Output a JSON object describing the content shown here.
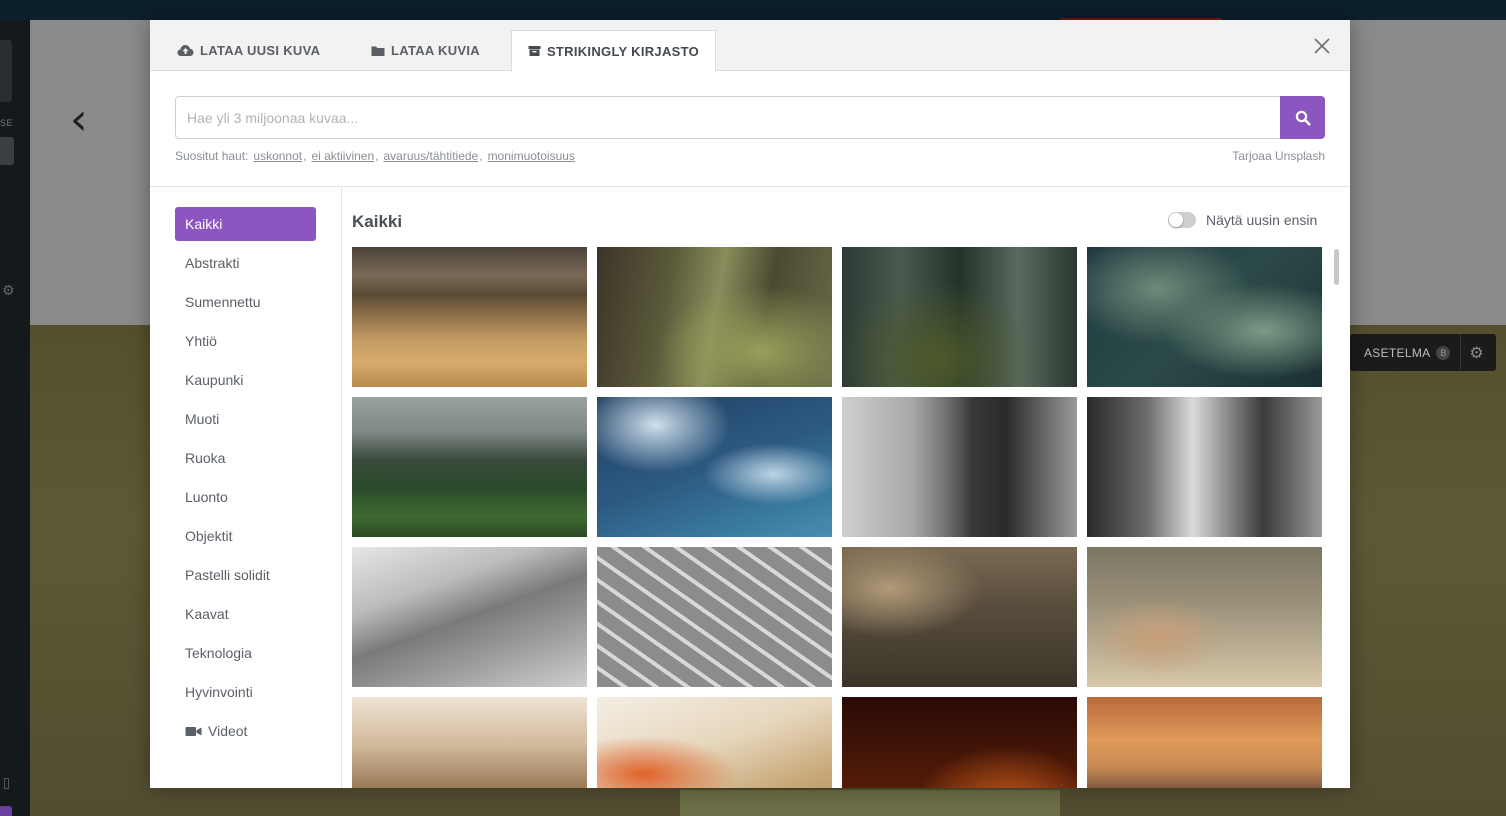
{
  "background": {
    "sidebar_label": "SE",
    "layout_button": {
      "label": "ASETELMA",
      "badge": "B"
    }
  },
  "modal": {
    "tabs": [
      {
        "label": "LATAA UUSI KUVA",
        "icon": "cloud-upload-icon"
      },
      {
        "label": "LATAA KUVIA",
        "icon": "folder-icon"
      },
      {
        "label": "STRIKINGLY KIRJASTO",
        "icon": "archive-box-icon",
        "active": true
      }
    ],
    "search": {
      "placeholder": "Hae yli 3 miljoonaa kuvaa...",
      "value": ""
    },
    "popular": {
      "label": "Suositut haut:",
      "terms": [
        "uskonnot",
        "ei aktiivinen",
        "avaruus/tähtitiede",
        "monimuotoisuus"
      ]
    },
    "provider": "Tarjoaa Unsplash",
    "categories": [
      "Kaikki",
      "Abstrakti",
      "Sumennettu",
      "Yhtiö",
      "Kaupunki",
      "Muoti",
      "Ruoka",
      "Luonto",
      "Objektit",
      "Pastelli solidit",
      "Kaavat",
      "Teknologia",
      "Hyvinvointi",
      "Videot"
    ],
    "active_category": "Kaikki",
    "section_title": "Kaikki",
    "toggle": {
      "label": "Näytä uusin ensin",
      "on": false
    },
    "accent_color": "#8c55c0",
    "thumbnails": [
      "golden-field-hills",
      "forest-path",
      "dark-forest",
      "palm-leaves",
      "green-hills-blur",
      "sky-clouds-blue",
      "bw-building-windows",
      "bw-city-street",
      "bw-train-station",
      "crosswalk-aerial",
      "city-aerial-skyscrapers",
      "city-rooftops",
      "office-interior",
      "orange-chair-desk",
      "sparks-dark",
      "skyline-sunset"
    ]
  }
}
